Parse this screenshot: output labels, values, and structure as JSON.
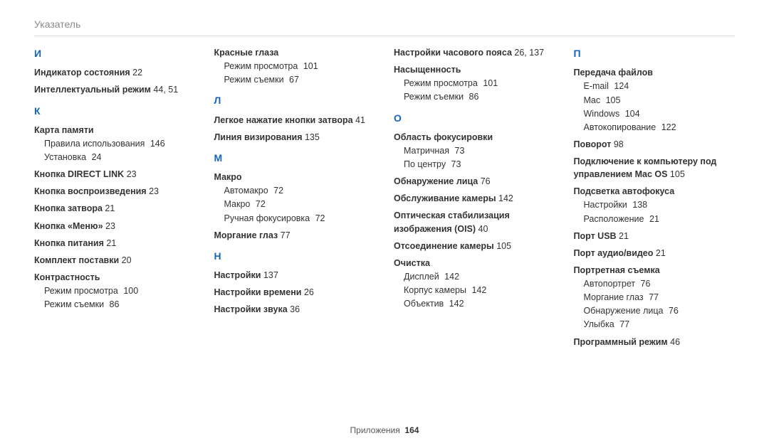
{
  "header": {
    "title": "Указатель"
  },
  "footer": {
    "label": "Приложения",
    "page": "164"
  },
  "columns": [
    {
      "blocks": [
        {
          "type": "letter",
          "text": "И",
          "first": true
        },
        {
          "type": "entry",
          "term": "Индикатор состояния",
          "pages": "22"
        },
        {
          "type": "entry",
          "term": "Интеллектуальный режим",
          "pages": "44, 51"
        },
        {
          "type": "letter",
          "text": "К"
        },
        {
          "type": "entry",
          "term": "Карта памяти",
          "sub": [
            {
              "label": "Правила использования",
              "pages": "146"
            },
            {
              "label": "Установка",
              "pages": "24"
            }
          ]
        },
        {
          "type": "entry",
          "term": "Кнопка DIRECT LINK",
          "pages": "23"
        },
        {
          "type": "entry",
          "term": "Кнопка воспроизведения",
          "pages": "23"
        },
        {
          "type": "entry",
          "term": "Кнопка затвора",
          "pages": "21"
        },
        {
          "type": "entry",
          "term": "Кнопка «Меню»",
          "pages": "23"
        },
        {
          "type": "entry",
          "term": "Кнопка питания",
          "pages": "21"
        },
        {
          "type": "entry",
          "term": "Комплект поставки",
          "pages": "20"
        },
        {
          "type": "entry",
          "term": "Контрастность",
          "sub": [
            {
              "label": "Режим просмотра",
              "pages": "100"
            },
            {
              "label": "Режим съемки",
              "pages": "86"
            }
          ]
        }
      ]
    },
    {
      "blocks": [
        {
          "type": "entry",
          "term": "Красные глаза",
          "first": true,
          "sub": [
            {
              "label": "Режим просмотра",
              "pages": "101"
            },
            {
              "label": "Режим съемки",
              "pages": "67"
            }
          ]
        },
        {
          "type": "letter",
          "text": "Л"
        },
        {
          "type": "entry",
          "term": "Легкое нажатие кнопки затвора",
          "pages": "41"
        },
        {
          "type": "entry",
          "term": "Линия визирования",
          "pages": "135"
        },
        {
          "type": "letter",
          "text": "М"
        },
        {
          "type": "entry",
          "term": "Макро",
          "sub": [
            {
              "label": "Автомакро",
              "pages": "72"
            },
            {
              "label": "Макро",
              "pages": "72"
            },
            {
              "label": "Ручная фокусировка",
              "pages": "72"
            }
          ]
        },
        {
          "type": "entry",
          "term": "Моргание глаз",
          "pages": "77"
        },
        {
          "type": "letter",
          "text": "Н"
        },
        {
          "type": "entry",
          "term": "Настройки",
          "pages": "137"
        },
        {
          "type": "entry",
          "term": "Настройки времени",
          "pages": "26"
        },
        {
          "type": "entry",
          "term": "Настройки звука",
          "pages": "36"
        }
      ]
    },
    {
      "blocks": [
        {
          "type": "entry",
          "term": "Настройки часового пояса",
          "pages": "26, 137",
          "first": true
        },
        {
          "type": "entry",
          "term": "Насыщенность",
          "sub": [
            {
              "label": "Режим просмотра",
              "pages": "101"
            },
            {
              "label": "Режим съемки",
              "pages": "86"
            }
          ]
        },
        {
          "type": "letter",
          "text": "О"
        },
        {
          "type": "entry",
          "term": "Область фокусировки",
          "sub": [
            {
              "label": "Матричная",
              "pages": "73"
            },
            {
              "label": "По центру",
              "pages": "73"
            }
          ]
        },
        {
          "type": "entry",
          "term": "Обнаружение лица",
          "pages": "76"
        },
        {
          "type": "entry",
          "term": "Обслуживание камеры",
          "pages": "142"
        },
        {
          "type": "entry",
          "term": "Оптическая стабилизация изображения (OIS)",
          "pages": "40"
        },
        {
          "type": "entry",
          "term": "Отсоединение камеры",
          "pages": "105"
        },
        {
          "type": "entry",
          "term": "Очистка",
          "sub": [
            {
              "label": "Дисплей",
              "pages": "142"
            },
            {
              "label": "Корпус камеры",
              "pages": "142"
            },
            {
              "label": "Объектив",
              "pages": "142"
            }
          ]
        }
      ]
    },
    {
      "blocks": [
        {
          "type": "letter",
          "text": "П",
          "first": true
        },
        {
          "type": "entry",
          "term": "Передача файлов",
          "sub": [
            {
              "label": "E-mail",
              "pages": "124"
            },
            {
              "label": "Mac",
              "pages": "105"
            },
            {
              "label": "Windows",
              "pages": "104"
            },
            {
              "label": "Автокопирование",
              "pages": "122"
            }
          ]
        },
        {
          "type": "entry",
          "term": "Поворот",
          "pages": "98"
        },
        {
          "type": "entry",
          "term": "Подключение к компьютеру под управлением Mac OS",
          "pages": "105"
        },
        {
          "type": "entry",
          "term": "Подсветка автофокуса",
          "sub": [
            {
              "label": "Настройки",
              "pages": "138"
            },
            {
              "label": "Расположение",
              "pages": "21"
            }
          ]
        },
        {
          "type": "entry",
          "term": "Порт USB",
          "pages": "21"
        },
        {
          "type": "entry",
          "term": "Порт аудио/видео",
          "pages": "21"
        },
        {
          "type": "entry",
          "term": "Портретная съемка",
          "sub": [
            {
              "label": "Автопортрет",
              "pages": "76"
            },
            {
              "label": "Моргание глаз",
              "pages": "77"
            },
            {
              "label": "Обнаружение лица",
              "pages": "76"
            },
            {
              "label": "Улыбка",
              "pages": "77"
            }
          ]
        },
        {
          "type": "entry",
          "term": "Программный режим",
          "pages": "46"
        }
      ]
    }
  ]
}
